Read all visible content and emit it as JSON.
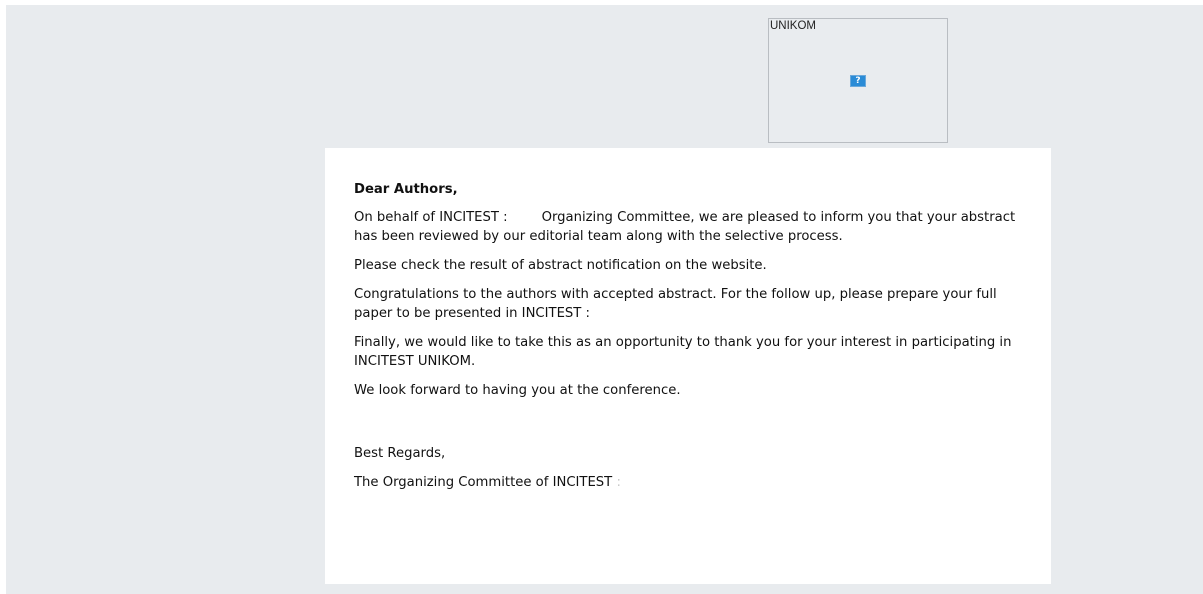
{
  "header": {
    "logo_alt_text": "UNIKOM",
    "broken_image_glyph": "?"
  },
  "letter": {
    "greeting": "Dear Authors,",
    "p1_a": "On behalf of INCITEST :",
    "p1_b": "Organizing Committee, we are pleased to inform you that your abstract has been reviewed by our editorial team along with the selective process.",
    "p2": "Please check the result of abstract notification on the website.",
    "p3": "Congratulations to the authors with accepted abstract. For the follow up, please prepare your full paper to be presented in INCITEST :",
    "p4": "Finally, we would like to take this as an opportunity to thank you for your interest in participating in INCITEST UNIKOM.",
    "p5": "We look forward to having you at the conference.",
    "closing": "Best Regards,",
    "signature": "The Organizing Committee of INCITEST",
    "signature_tail": ":"
  }
}
